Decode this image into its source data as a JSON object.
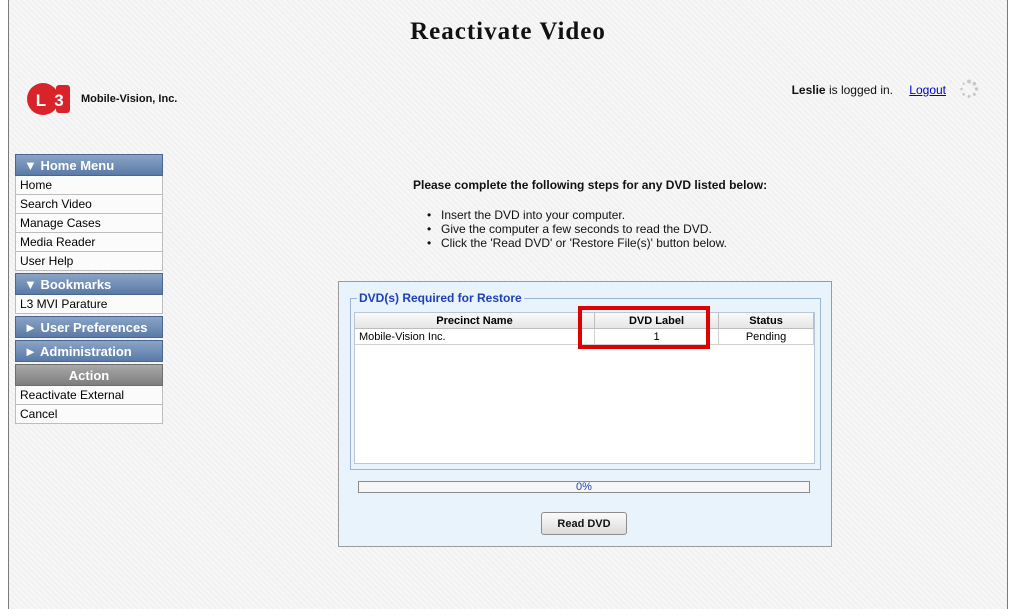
{
  "page": {
    "title": "Reactivate Video"
  },
  "brand": {
    "logo_letters": "L3",
    "company": "Mobile-Vision, Inc."
  },
  "session": {
    "user": "Leslie",
    "status_text": " is logged in.",
    "logout_label": "Logout"
  },
  "sidebar": {
    "home_menu": {
      "label": "▼ Home Menu",
      "items": [
        "Home",
        "Search Video",
        "Manage Cases",
        "Media Reader",
        "User Help"
      ]
    },
    "bookmarks": {
      "label": "▼ Bookmarks",
      "items": [
        "L3 MVI Parature"
      ]
    },
    "user_prefs": {
      "label": "► User Preferences"
    },
    "administration": {
      "label": "► Administration"
    },
    "action": {
      "label": "Action",
      "items": [
        "Reactivate External",
        "Cancel"
      ]
    }
  },
  "instructions": {
    "heading": "Please complete the following steps for any DVD listed below:",
    "steps": [
      "Insert the DVD into your computer.",
      "Give the computer a few seconds to read the DVD.",
      "Click the 'Read DVD' or 'Restore File(s)' button below."
    ]
  },
  "restore": {
    "legend": "DVD(s) Required for Restore",
    "columns": [
      "Precinct Name",
      "DVD Label",
      "Status"
    ],
    "rows": [
      {
        "precinct": "Mobile-Vision Inc.",
        "label": "1",
        "status": "Pending"
      }
    ],
    "progress_percent": 0,
    "progress_label": "0%",
    "read_button": "Read DVD"
  },
  "colors": {
    "highlight": "#e00000",
    "menu_blue": "#5a7aa6",
    "link": "#0000cc"
  }
}
